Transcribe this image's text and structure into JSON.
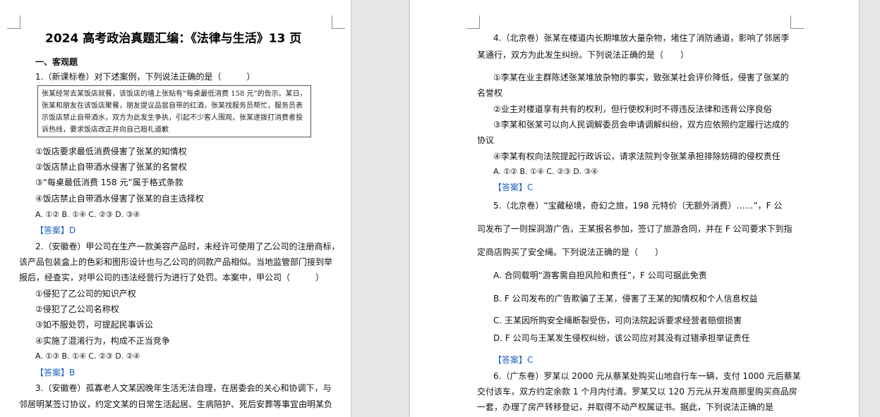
{
  "left": {
    "title": "2024 高考政治真题汇编：《法律与生活》13 页",
    "section": "一、客观题",
    "q1": {
      "stem": "1.（新课标卷）对下述案例，下列说法正确的是（　　　）",
      "case": [
        "张某经常去某饭店就餐，该饭店的墙上张贴有“每桌最低消费 158 元”的告示。某日，",
        "张某和朋友在该饭店聚餐，朋友提议品尝自带的红酒，张某找服务员帮忙，服务员表",
        "示饭店禁止自带酒水，双方为此发生争执，引起不少客人围观，张某遂拨打消费者投",
        "诉热线，要求饭店改正并向自己赔礼道歉"
      ],
      "options": [
        "①饭店要求最低消费侵害了张某的知情权",
        "②饭店禁止自带酒水侵害了张某的名誉权",
        "③“每桌最低消费 158 元”属于格式条款",
        "④饭店禁止自带酒水侵害了张某的自主选择权"
      ],
      "choices": "A. ①② B. ①④ C. ②③ D. ③④",
      "answer": "【答案】D"
    },
    "q2": {
      "stem": [
        "2.（安徽卷）甲公司在生产一款美容产品时，未经许可使用了乙公司的注册商标，",
        "该产品包装盒上的色彩和图形设计也与乙公司的同款产品相似。当地监管部门接到举",
        "报后，经查实，对甲公司的违法经营行为进行了处罚。本案中，甲公司（　　　）"
      ],
      "options": [
        "①侵犯了乙公司的知识产权",
        "②侵犯了乙公司名称权",
        "③如不服处罚，可提起民事诉讼",
        "④实施了混淆行为，构成不正当竞争"
      ],
      "choices": "A. ①③ B. ①④ C. ②③ D. ②④",
      "answer": "【答案】B"
    },
    "q3": {
      "stem": [
        "3.（安徽卷）孤寡老人文某因晚年生活无法自理，在居委会的关心和协调下，与",
        "邻居明某签订协议，约定文某的日常生活起居、生病陪护、死后安葬等事宜由明某负"
      ]
    }
  },
  "right": {
    "q4": {
      "stem": [
        "4.（北京卷）张某在楼道内长期堆放大量杂物，堵住了消防通道，影响了邻居李",
        "某通行，双方为此发生纠纷。下列说法正确的是（　　）"
      ],
      "opt1": [
        "①李某在业主群陈述张某堆放杂物的事实，致张某社会评价降低，侵害了张某的",
        "名誉权"
      ],
      "opt2": "②业主对楼道享有共有的权利，但行使权利时不得违反法律和违背公序良俗",
      "opt3": [
        "③李某和张某可以向人民调解委员会申请调解纠纷，双方应依照约定履行达成的",
        "协议"
      ],
      "opt4": "④李某有权向法院提起行政诉讼，请求法院判令张某承担排除妨碍的侵权责任",
      "choices": "A. ①② B. ①④ C. ②③ D. ③④",
      "answer": "【答案】C"
    },
    "q5": {
      "stem": [
        "5.（北京卷）“宝藏秘境，奇幻之旅，198 元特价（无额外消费）……”，F 公",
        "司发布了一则探洞游广告。王某报名参加，签订了旅游合同，并在 F 公司要求下到指",
        "定商店购买了安全绳。下列说法正确的是（　　）"
      ],
      "options": [
        "A. 合同载明“游客需自担风险和责任”，F 公司可据此免责",
        "B. F 公司发布的广告欺骗了王某，侵害了王某的知情权和个人信息权益",
        "C. 王某因所购安全绳断裂受伤，可向法院起诉要求经营者赔偿损害",
        "D. F 公司与王某发生侵权纠纷，该公司应对其没有过错承担举证责任"
      ],
      "answer": "【答案】C"
    },
    "q6": {
      "stem": [
        "6.（广东卷）罗某以 2000 元从蔡某处购买山地自行车一辆，支付 1000 元后蔡某",
        "交付该车，双方约定余款 1 个月内付清。罗某又以 120 万元从开发商那里购买商品房",
        "一套，办理了房产转移登记，并取得不动产权属证书。据此，下列说法正确的是"
      ]
    }
  }
}
